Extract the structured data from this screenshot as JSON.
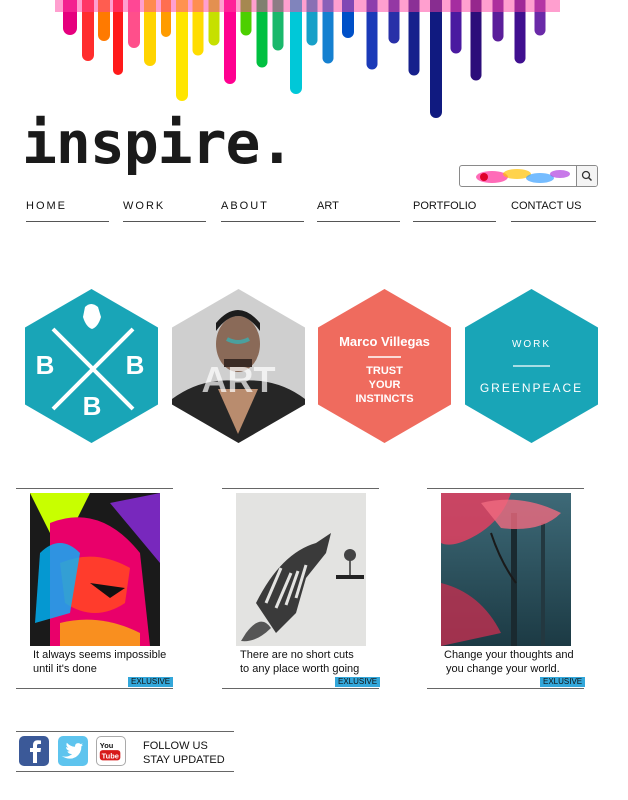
{
  "brand": {
    "logo_text": "inspire."
  },
  "search": {
    "placeholder": ""
  },
  "nav": {
    "items": [
      {
        "label": "HOME"
      },
      {
        "label": "WORK"
      },
      {
        "label": "ABOUT"
      },
      {
        "label": "ART"
      },
      {
        "label": "PORTFOLIO"
      },
      {
        "label": "CONTACT US"
      }
    ]
  },
  "hexes": {
    "bb": {
      "left": "B",
      "right": "B",
      "bottom": "B",
      "color": "#19a5b7"
    },
    "art": {
      "label": "ART"
    },
    "marco": {
      "name": "Marco Villegas",
      "line1": "TRUST",
      "line2": "YOUR",
      "line3": "INSTINCTS",
      "color": "#ef6b5e"
    },
    "work": {
      "title": "WORK",
      "subtitle": "GREENPEACE",
      "color": "#19a5b7"
    }
  },
  "gallery": {
    "items": [
      {
        "caption1": "It always seems impossible",
        "caption2": "until it's done",
        "badge": "EXLUSIVE"
      },
      {
        "caption1": "There are no short cuts",
        "caption2": "to any place worth going",
        "badge": "EXLUSIVE"
      },
      {
        "caption1": "Change your thoughts and",
        "caption2": "you change your world.",
        "badge": "EXLUSIVE"
      }
    ]
  },
  "social": {
    "facebook_icon": "facebook-icon",
    "twitter_icon": "twitter-icon",
    "youtube_icon": "youtube-icon",
    "youtube_text": "You Tube",
    "follow1": "FOLLOW US",
    "follow2": "STAY UPDATED"
  }
}
